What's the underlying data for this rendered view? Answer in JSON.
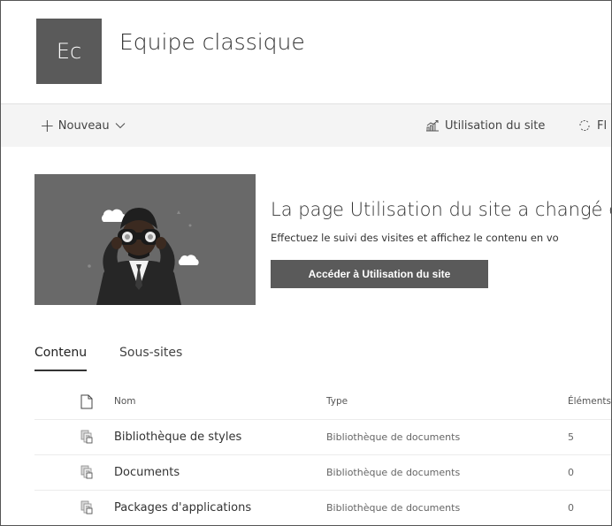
{
  "site": {
    "logo_text": "Ec",
    "title": "Equipe classique"
  },
  "command_bar": {
    "new_label": "Nouveau",
    "usage_label": "Utilisation du site",
    "flow_label": "Fl"
  },
  "banner": {
    "title": "La page Utilisation du site a changé de",
    "description": "Effectuez le suivi des visites et affichez le contenu en vo",
    "button_label": "Accéder à Utilisation du site"
  },
  "tabs": [
    {
      "label": "Contenu",
      "active": true
    },
    {
      "label": "Sous-sites",
      "active": false
    }
  ],
  "table": {
    "headers": {
      "name": "Nom",
      "type": "Type",
      "count": "Éléments"
    },
    "rows": [
      {
        "name": "Bibliothèque de styles",
        "type": "Bibliothèque de documents",
        "count": "5"
      },
      {
        "name": "Documents",
        "type": "Bibliothèque de documents",
        "count": "0"
      },
      {
        "name": "Packages d'applications",
        "type": "Bibliothèque de documents",
        "count": "0"
      }
    ]
  },
  "colors": {
    "logo_bg": "#5a5a5a",
    "command_bar_bg": "#f4f4f4",
    "banner_bg": "#696969",
    "button_bg": "#5a5a5a"
  }
}
